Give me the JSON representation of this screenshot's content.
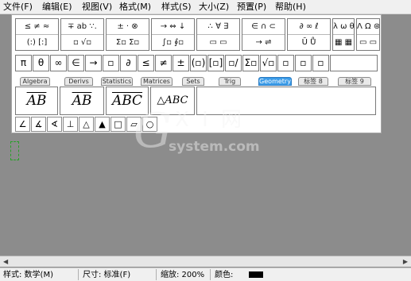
{
  "menu": [
    "文件(F)",
    "编辑(E)",
    "视图(V)",
    "格式(M)",
    "样式(S)",
    "大小(Z)",
    "预置(P)",
    "帮助(H)"
  ],
  "palettes_top": [
    {
      "top": "≤ ≠ ≈",
      "bottom": "(:) [:]"
    },
    {
      "top": "∓ ab ∵.",
      "bottom": "▫ √▫"
    },
    {
      "top": "± · ⊗",
      "bottom": "Σ▫ Σ▫"
    },
    {
      "top": "→ ⇔ ↓",
      "bottom": "∫▫ ∮▫"
    },
    {
      "top": "∴ ∀ ∃",
      "bottom": "▭ ▭"
    },
    {
      "top": "∈ ∩ ⊂",
      "bottom": "→ ⇌"
    },
    {
      "top": "∂ ∞ ℓ",
      "bottom": "Ū Ů"
    },
    {
      "top": "λ ω θ",
      "bottom": "▦ ▦"
    },
    {
      "top": "Λ Ω ⊛",
      "bottom": "▭ ▭"
    }
  ],
  "palette_row2": [
    "π",
    "θ",
    "∞",
    "∈",
    "→",
    "▫",
    "∂",
    "≤",
    "≠",
    "±",
    "(▫)",
    "[▫]",
    "▫/▫",
    "Σ▫",
    "√▫",
    "▫",
    "▫",
    "▫"
  ],
  "tabs": [
    "Algebra",
    "Derivs",
    "Statistics",
    "Matrices",
    "Sets",
    "Trig",
    "Geometry",
    "标签 8",
    "标签 9"
  ],
  "templates": [
    "AB",
    "AB",
    "ABC",
    "△ABC"
  ],
  "shapes": [
    "∠",
    "∡",
    "∢",
    "⊥",
    "△",
    "▲",
    "□",
    "▱",
    "○"
  ],
  "watermark": {
    "letter": "G",
    "cn": "X I 网",
    "url": "system.com"
  },
  "status": {
    "style": "样式: 数学(M)",
    "size": "尺寸: 标准(F)",
    "zoom": "缩放: 200%",
    "color": "颜色:"
  }
}
